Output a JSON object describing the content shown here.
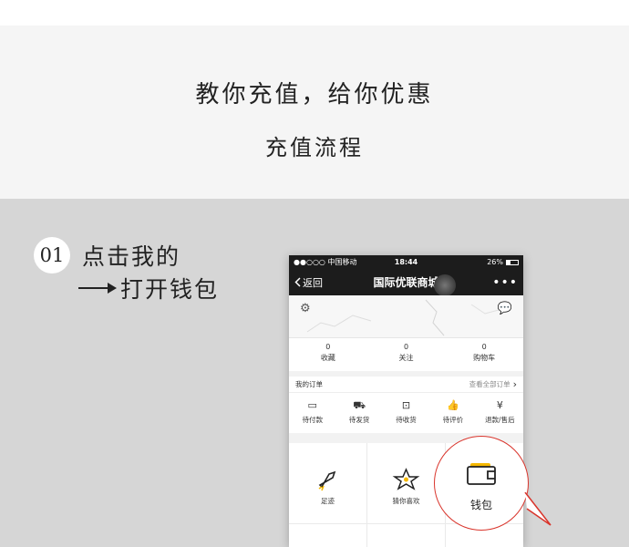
{
  "header": {
    "title_line1": "教你充值，给你优惠",
    "title_line2": "充值流程"
  },
  "step": {
    "number": "01",
    "line1": "点击我的",
    "line2": "打开钱包"
  },
  "phone": {
    "status": {
      "carrier": "●●○○○ 中国移动",
      "time": "18:44",
      "battery": "26%"
    },
    "nav": {
      "back_label": "返回",
      "title": "国际优联商城",
      "more": "•••"
    },
    "stats": [
      {
        "count": "0",
        "label": "收藏"
      },
      {
        "count": "0",
        "label": "关注"
      },
      {
        "count": "0",
        "label": "购物车"
      }
    ],
    "orders": {
      "title": "我的订单",
      "view_all": "查看全部订单",
      "items": [
        {
          "label": "待付款",
          "icon": "wallet-small-icon"
        },
        {
          "label": "待发货",
          "icon": "truck-icon"
        },
        {
          "label": "待收货",
          "icon": "box-icon"
        },
        {
          "label": "待评价",
          "icon": "thumbs-up-icon"
        },
        {
          "label": "退款/售后",
          "icon": "yen-icon"
        }
      ]
    },
    "grid": [
      {
        "label": "足迹",
        "icon": "rocket-icon"
      },
      {
        "label": "猜你喜欢",
        "icon": "star-icon"
      },
      {
        "label": "钱包",
        "icon": "wallet-icon"
      }
    ]
  },
  "callout": {
    "label": "钱包",
    "icon": "wallet-icon",
    "accent_color": "#d9342b",
    "highlight_color": "#f5b800"
  }
}
